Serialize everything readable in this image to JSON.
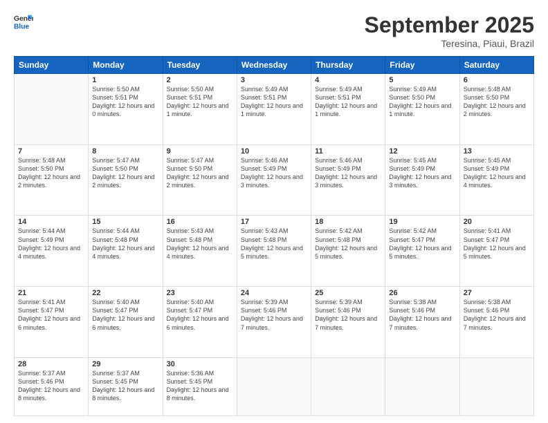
{
  "header": {
    "logo_general": "General",
    "logo_blue": "Blue",
    "title": "September 2025",
    "subtitle": "Teresina, Piaui, Brazil"
  },
  "days_of_week": [
    "Sunday",
    "Monday",
    "Tuesday",
    "Wednesday",
    "Thursday",
    "Friday",
    "Saturday"
  ],
  "weeks": [
    [
      {
        "day": "",
        "info": ""
      },
      {
        "day": "1",
        "info": "Sunrise: 5:50 AM\nSunset: 5:51 PM\nDaylight: 12 hours\nand 0 minutes."
      },
      {
        "day": "2",
        "info": "Sunrise: 5:50 AM\nSunset: 5:51 PM\nDaylight: 12 hours\nand 1 minute."
      },
      {
        "day": "3",
        "info": "Sunrise: 5:49 AM\nSunset: 5:51 PM\nDaylight: 12 hours\nand 1 minute."
      },
      {
        "day": "4",
        "info": "Sunrise: 5:49 AM\nSunset: 5:51 PM\nDaylight: 12 hours\nand 1 minute."
      },
      {
        "day": "5",
        "info": "Sunrise: 5:49 AM\nSunset: 5:50 PM\nDaylight: 12 hours\nand 1 minute."
      },
      {
        "day": "6",
        "info": "Sunrise: 5:48 AM\nSunset: 5:50 PM\nDaylight: 12 hours\nand 2 minutes."
      }
    ],
    [
      {
        "day": "7",
        "info": "Sunrise: 5:48 AM\nSunset: 5:50 PM\nDaylight: 12 hours\nand 2 minutes."
      },
      {
        "day": "8",
        "info": "Sunrise: 5:47 AM\nSunset: 5:50 PM\nDaylight: 12 hours\nand 2 minutes."
      },
      {
        "day": "9",
        "info": "Sunrise: 5:47 AM\nSunset: 5:50 PM\nDaylight: 12 hours\nand 2 minutes."
      },
      {
        "day": "10",
        "info": "Sunrise: 5:46 AM\nSunset: 5:49 PM\nDaylight: 12 hours\nand 3 minutes."
      },
      {
        "day": "11",
        "info": "Sunrise: 5:46 AM\nSunset: 5:49 PM\nDaylight: 12 hours\nand 3 minutes."
      },
      {
        "day": "12",
        "info": "Sunrise: 5:45 AM\nSunset: 5:49 PM\nDaylight: 12 hours\nand 3 minutes."
      },
      {
        "day": "13",
        "info": "Sunrise: 5:45 AM\nSunset: 5:49 PM\nDaylight: 12 hours\nand 4 minutes."
      }
    ],
    [
      {
        "day": "14",
        "info": "Sunrise: 5:44 AM\nSunset: 5:49 PM\nDaylight: 12 hours\nand 4 minutes."
      },
      {
        "day": "15",
        "info": "Sunrise: 5:44 AM\nSunset: 5:48 PM\nDaylight: 12 hours\nand 4 minutes."
      },
      {
        "day": "16",
        "info": "Sunrise: 5:43 AM\nSunset: 5:48 PM\nDaylight: 12 hours\nand 4 minutes."
      },
      {
        "day": "17",
        "info": "Sunrise: 5:43 AM\nSunset: 5:48 PM\nDaylight: 12 hours\nand 5 minutes."
      },
      {
        "day": "18",
        "info": "Sunrise: 5:42 AM\nSunset: 5:48 PM\nDaylight: 12 hours\nand 5 minutes."
      },
      {
        "day": "19",
        "info": "Sunrise: 5:42 AM\nSunset: 5:47 PM\nDaylight: 12 hours\nand 5 minutes."
      },
      {
        "day": "20",
        "info": "Sunrise: 5:41 AM\nSunset: 5:47 PM\nDaylight: 12 hours\nand 5 minutes."
      }
    ],
    [
      {
        "day": "21",
        "info": "Sunrise: 5:41 AM\nSunset: 5:47 PM\nDaylight: 12 hours\nand 6 minutes."
      },
      {
        "day": "22",
        "info": "Sunrise: 5:40 AM\nSunset: 5:47 PM\nDaylight: 12 hours\nand 6 minutes."
      },
      {
        "day": "23",
        "info": "Sunrise: 5:40 AM\nSunset: 5:47 PM\nDaylight: 12 hours\nand 6 minutes."
      },
      {
        "day": "24",
        "info": "Sunrise: 5:39 AM\nSunset: 5:46 PM\nDaylight: 12 hours\nand 7 minutes."
      },
      {
        "day": "25",
        "info": "Sunrise: 5:39 AM\nSunset: 5:46 PM\nDaylight: 12 hours\nand 7 minutes."
      },
      {
        "day": "26",
        "info": "Sunrise: 5:38 AM\nSunset: 5:46 PM\nDaylight: 12 hours\nand 7 minutes."
      },
      {
        "day": "27",
        "info": "Sunrise: 5:38 AM\nSunset: 5:46 PM\nDaylight: 12 hours\nand 7 minutes."
      }
    ],
    [
      {
        "day": "28",
        "info": "Sunrise: 5:37 AM\nSunset: 5:46 PM\nDaylight: 12 hours\nand 8 minutes."
      },
      {
        "day": "29",
        "info": "Sunrise: 5:37 AM\nSunset: 5:45 PM\nDaylight: 12 hours\nand 8 minutes."
      },
      {
        "day": "30",
        "info": "Sunrise: 5:36 AM\nSunset: 5:45 PM\nDaylight: 12 hours\nand 8 minutes."
      },
      {
        "day": "",
        "info": ""
      },
      {
        "day": "",
        "info": ""
      },
      {
        "day": "",
        "info": ""
      },
      {
        "day": "",
        "info": ""
      }
    ]
  ]
}
